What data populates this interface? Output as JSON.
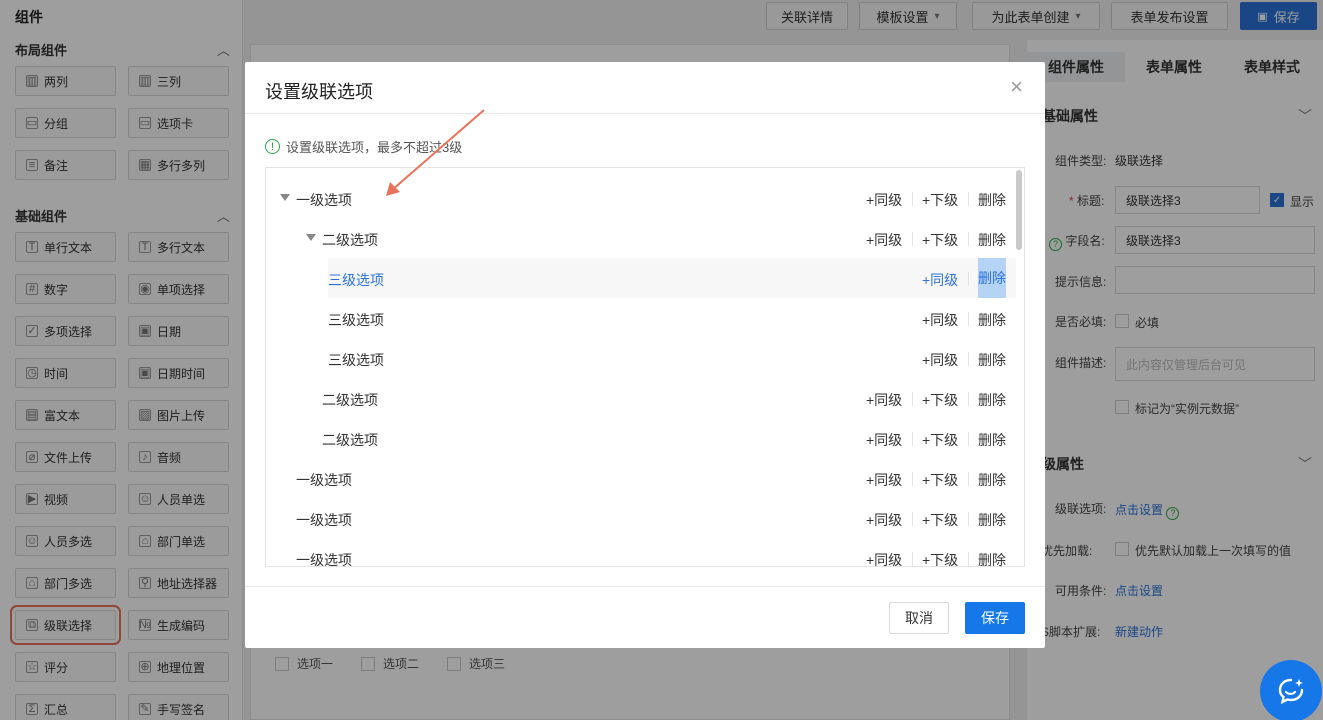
{
  "left_panel": {
    "title": "组件",
    "layout_group": {
      "title": "布局组件",
      "chevron": "︿"
    },
    "layout_items": [
      {
        "label": "两列",
        "icon": "two-column-icon",
        "glyph": "▥"
      },
      {
        "label": "三列",
        "icon": "three-column-icon",
        "glyph": "▥"
      },
      {
        "label": "分组",
        "icon": "folder-icon",
        "glyph": "▭"
      },
      {
        "label": "选项卡",
        "icon": "tab-icon",
        "glyph": "▭"
      },
      {
        "label": "备注",
        "icon": "note-icon",
        "glyph": "≡"
      },
      {
        "label": "多行多列",
        "icon": "grid-icon",
        "glyph": "▦"
      }
    ],
    "basic_group": {
      "title": "基础组件",
      "chevron": "︿"
    },
    "basic_items": [
      {
        "label": "单行文本",
        "icon": "text-icon",
        "glyph": "T"
      },
      {
        "label": "多行文本",
        "icon": "multiline-text-icon",
        "glyph": "T"
      },
      {
        "label": "数字",
        "icon": "number-icon",
        "glyph": "#"
      },
      {
        "label": "单项选择",
        "icon": "radio-icon",
        "glyph": "◉"
      },
      {
        "label": "多项选择",
        "icon": "checkbox-icon",
        "glyph": "✓"
      },
      {
        "label": "日期",
        "icon": "calendar-icon",
        "glyph": "▣"
      },
      {
        "label": "时间",
        "icon": "clock-icon",
        "glyph": "◷"
      },
      {
        "label": "日期时间",
        "icon": "datetime-icon",
        "glyph": "▣"
      },
      {
        "label": "富文本",
        "icon": "richtext-icon",
        "glyph": "▤"
      },
      {
        "label": "图片上传",
        "icon": "image-icon",
        "glyph": "▨"
      },
      {
        "label": "文件上传",
        "icon": "attachment-icon",
        "glyph": "⌀"
      },
      {
        "label": "音频",
        "icon": "audio-icon",
        "glyph": "♪"
      },
      {
        "label": "视频",
        "icon": "video-icon",
        "glyph": "▶"
      },
      {
        "label": "人员单选",
        "icon": "user-icon",
        "glyph": "☺"
      },
      {
        "label": "人员多选",
        "icon": "users-icon",
        "glyph": "☺"
      },
      {
        "label": "部门单选",
        "icon": "department-icon",
        "glyph": "⌂"
      },
      {
        "label": "部门多选",
        "icon": "departments-icon",
        "glyph": "⌂"
      },
      {
        "label": "地址选择器",
        "icon": "location-pin-icon",
        "glyph": "⚲"
      },
      {
        "label": "级联选择",
        "icon": "cascade-icon",
        "glyph": "⧉"
      },
      {
        "label": "生成编码",
        "icon": "code-number-icon",
        "glyph": "№"
      },
      {
        "label": "评分",
        "icon": "star-icon",
        "glyph": "☆"
      },
      {
        "label": "地理位置",
        "icon": "geo-target-icon",
        "glyph": "⊕"
      },
      {
        "label": "汇总",
        "icon": "sum-icon",
        "glyph": "Σ"
      },
      {
        "label": "手写签名",
        "icon": "signature-icon",
        "glyph": "✎"
      }
    ]
  },
  "toolbar": {
    "related_details": "关联详情",
    "template_settings": "模板设置",
    "template_caret": "▾",
    "create_for_form": "为此表单创建",
    "create_caret": "▾",
    "publish_settings": "表单发布设置",
    "save": "保存",
    "save_icon_glyph": "▣"
  },
  "canvas": {
    "options": [
      "选项一",
      "选项二",
      "选项三"
    ]
  },
  "right_panel": {
    "tabs": [
      "组件属性",
      "表单属性",
      "表单样式"
    ],
    "basic_section": "基础属性",
    "basic_chevron": "﹀",
    "component_type_label": "组件类型:",
    "component_type_value": "级联选择",
    "title_required_mark": "*",
    "title_label": "标题:",
    "title_value": "级联选择3",
    "show_checkbox_glyph": "✓",
    "show_label": "显示",
    "field_name_help": "?",
    "field_name_label": "字段名:",
    "field_name_value": "级联选择3",
    "hint_label": "提示信息:",
    "hint_value": "",
    "required_label": "是否必填:",
    "required_checkbox_label": "必填",
    "description_label": "组件描述:",
    "description_placeholder": "此内容仅管理后台可见",
    "instance_meta_label": "标记为“实例元数据”",
    "advanced_section": "级属性",
    "advanced_chevron": "﹀",
    "cascade_options_label": "级联选项:",
    "cascade_options_link": "点击设置",
    "cascade_help": "?",
    "priority_label": "优先加载:",
    "priority_checkbox_label": "优先默认加载上一次填写的值",
    "condition_label": "可用条件:",
    "condition_link": "点击设置",
    "js_label": "JS脚本扩展:",
    "js_link": "新建动作"
  },
  "modal": {
    "title": "设置级联选项",
    "close_glyph": "×",
    "tip_icon_glyph": "!",
    "tip": "设置级联选项，最多不超过3级",
    "rows": [
      {
        "level": 1,
        "label": "一级选项",
        "expanded": true,
        "selected": false
      },
      {
        "level": 2,
        "label": "二级选项",
        "expanded": true,
        "selected": false
      },
      {
        "level": 3,
        "label": "三级选项",
        "expanded": false,
        "selected": true
      },
      {
        "level": 3,
        "label": "三级选项",
        "expanded": false,
        "selected": false
      },
      {
        "level": 3,
        "label": "三级选项",
        "expanded": false,
        "selected": false
      },
      {
        "level": 2,
        "label": "二级选项",
        "expanded": false,
        "selected": false
      },
      {
        "level": 2,
        "label": "二级选项",
        "expanded": false,
        "selected": false
      },
      {
        "level": 1,
        "label": "一级选项",
        "expanded": false,
        "selected": false
      },
      {
        "level": 1,
        "label": "一级选项",
        "expanded": false,
        "selected": false
      },
      {
        "level": 1,
        "label": "一级选项",
        "expanded": false,
        "selected": false
      }
    ],
    "actions": {
      "same_level": "+同级",
      "sub_level": "+下级",
      "delete": "删除"
    },
    "cancel": "取消",
    "save": "保存"
  },
  "colors": {
    "primary": "#1677e8",
    "annotation_arrow": "#e8735a",
    "success": "#2aa845"
  }
}
